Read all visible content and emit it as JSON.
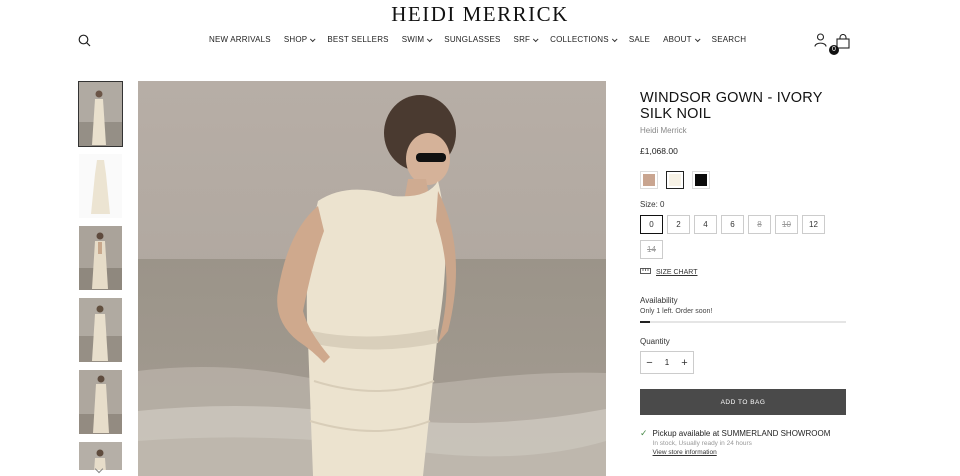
{
  "header": {
    "logo": "HEIDI MERRICK",
    "bag_count": "0",
    "nav": [
      {
        "label": "NEW ARRIVALS",
        "dropdown": false
      },
      {
        "label": "SHOP",
        "dropdown": true
      },
      {
        "label": "BEST SELLERS",
        "dropdown": false
      },
      {
        "label": "SWIM",
        "dropdown": true
      },
      {
        "label": "SUNGLASSES",
        "dropdown": false
      },
      {
        "label": "SRF",
        "dropdown": true
      },
      {
        "label": "COLLECTIONS",
        "dropdown": true
      },
      {
        "label": "SALE",
        "dropdown": false
      },
      {
        "label": "ABOUT",
        "dropdown": true
      },
      {
        "label": "SEARCH",
        "dropdown": false
      }
    ],
    "icons": {
      "search": "search-icon",
      "account": "user-icon",
      "bag": "shopping-bag-icon"
    }
  },
  "product": {
    "title": "WINDSOR GOWN - IVORY SILK NOIL",
    "brand": "Heidi Merrick",
    "price": "£1,068.00",
    "swatches": [
      {
        "color": "#c9a590",
        "active": false
      },
      {
        "color": "#f7f2e6",
        "active": true
      },
      {
        "color": "#0a0a0a",
        "active": false
      }
    ],
    "size_label": "Size: 0",
    "sizes": [
      {
        "label": "0",
        "active": true,
        "sold": false
      },
      {
        "label": "2",
        "active": false,
        "sold": false
      },
      {
        "label": "4",
        "active": false,
        "sold": false
      },
      {
        "label": "6",
        "active": false,
        "sold": false
      },
      {
        "label": "8",
        "active": false,
        "sold": true
      },
      {
        "label": "10",
        "active": false,
        "sold": true
      },
      {
        "label": "12",
        "active": false,
        "sold": false
      },
      {
        "label": "14",
        "active": false,
        "sold": true
      }
    ],
    "size_chart": "SIZE CHART",
    "availability_label": "Availability",
    "availability_text": "Only 1 left. Order soon!",
    "stock_level": 0.05,
    "quantity_label": "Quantity",
    "quantity": "1",
    "add_to_bag": "ADD TO BAG",
    "pickup_main": "Pickup available at SUMMERLAND SHOWROOM",
    "pickup_sub": "In stock, Usually ready in 24 hours",
    "pickup_link": "View store information"
  },
  "colors": {
    "accent": "#4a4a4a",
    "check": "#4a8a4a",
    "sand": "#a8a298"
  }
}
